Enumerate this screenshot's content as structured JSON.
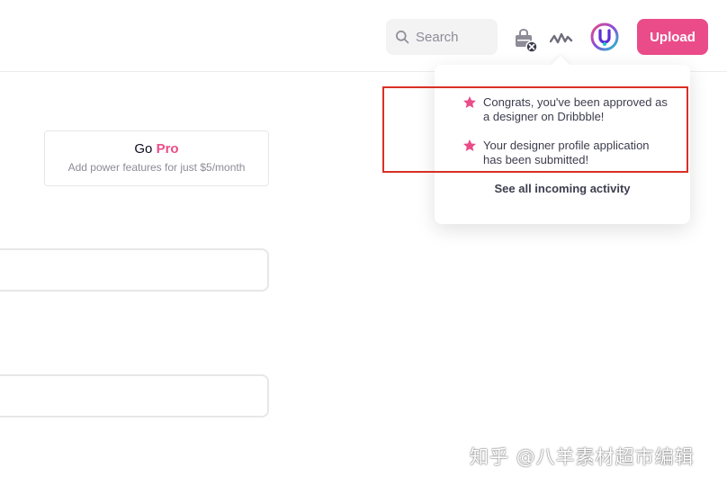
{
  "header": {
    "search_placeholder": "Search",
    "upload_label": "Upload",
    "icons": [
      "search-icon",
      "shopping-bag-icon",
      "activity-icon",
      "avatar"
    ]
  },
  "promo": {
    "go": "Go",
    "pro": "Pro",
    "subtitle": "Add power features for just $5/month"
  },
  "notifications": {
    "items": [
      {
        "icon": "star-icon",
        "text": "Congrats, you've been approved as a designer on Dribbble!"
      },
      {
        "icon": "star-icon",
        "text": "Your designer profile application has been submitted!"
      }
    ],
    "see_all_label": "See all incoming activity"
  },
  "watermark": {
    "text": "知乎 @八羊素材超市编辑"
  },
  "colors": {
    "brand_pink": "#ea4c89",
    "highlight_red": "#d93025",
    "search_bg": "#f3f3f4"
  }
}
